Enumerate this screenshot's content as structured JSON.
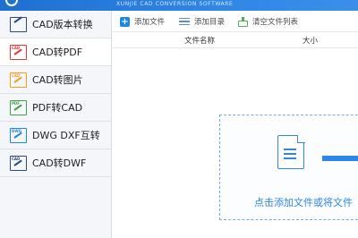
{
  "header": {
    "subtitle": "XUNJIE CAD CONVERSION SOFTWARE"
  },
  "sidebar": {
    "items": [
      {
        "label": "CAD版本转换",
        "icon": "cad-version-convert-icon",
        "color": "#2c4a7a",
        "active": false
      },
      {
        "label": "CAD转PDF",
        "icon": "cad-to-pdf-icon",
        "color": "#e53935",
        "active": true
      },
      {
        "label": "CAD转图片",
        "icon": "cad-to-image-icon",
        "color": "#f0a020",
        "active": false
      },
      {
        "label": "PDF转CAD",
        "icon": "pdf-to-cad-icon",
        "color": "#43a047",
        "active": false
      },
      {
        "label": "DWG DXF互转",
        "icon": "dwg-dxf-convert-icon",
        "color": "#1e88e5",
        "active": false
      },
      {
        "label": "CAD转DWF",
        "icon": "cad-to-dwf-icon",
        "color": "#2c4a7a",
        "active": false
      }
    ]
  },
  "toolbar": {
    "add_file": "添加文件",
    "add_folder": "添加目录",
    "clear_list": "清空文件列表"
  },
  "table": {
    "col_name": "文件名称",
    "col_size": "大小"
  },
  "drop_zone": {
    "text": "点击添加文件或将文件"
  },
  "colors": {
    "accent": "#2f86e6",
    "header": "#1e6fd0"
  }
}
